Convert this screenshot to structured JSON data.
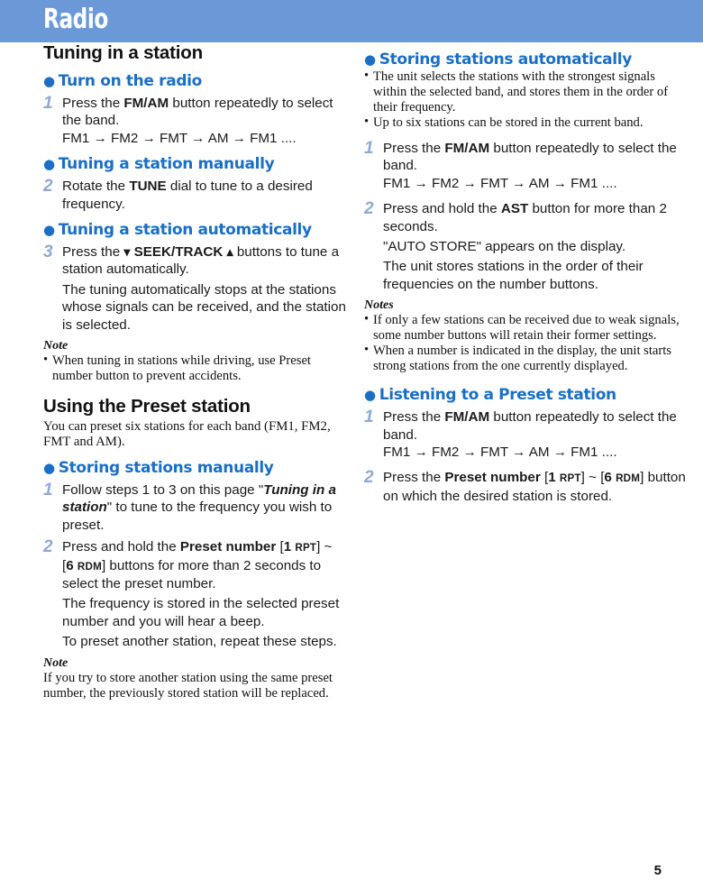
{
  "header": {
    "title": "Radio",
    "bar_color": "#6b99d8"
  },
  "colors": {
    "accent_blue": "#1a6fc4",
    "step_number_blue": "#8fa9d4",
    "header_blue": "#6b99d8"
  },
  "page_number": "5",
  "left_column": {
    "section_title": "Tuning in a station",
    "bullet_1": {
      "bullet": "●",
      "label": "Turn on the radio"
    },
    "step_1": {
      "number": "1",
      "line_prefix": "Press the ",
      "button": "FM/AM",
      "line_suffix": " button repeatedly to select the band.",
      "band_sequence": "FM1 → FM2 → FMT → AM → FM1 ...."
    },
    "bullet_2": {
      "bullet": "●",
      "label": "Tuning a station manually"
    },
    "step_2": {
      "number": "2",
      "line_prefix": "Rotate the ",
      "button": "TUNE",
      "line_suffix": " dial to tune to a desired frequency."
    },
    "bullet_3": {
      "bullet": "●",
      "label": "Tuning a station automatically"
    },
    "step_3": {
      "number": "3",
      "line_prefix": "Press the ",
      "chevron_down": "⌄",
      "button": "SEEK/TRACK",
      "chevron_up": "⌃",
      "line_suffix": " buttons to tune a station automatically.",
      "sub_line": "The tuning automatically stops at the stations whose signals can be received, and the station is selected."
    },
    "note": {
      "label": "Note",
      "bullet": "•",
      "text": "When tuning in stations while driving, use Preset number button to prevent accidents."
    },
    "section_title_2": "Using the Preset station",
    "intro_paragraph": "You can preset six stations for each band (FM1, FM2, FMT and AM).",
    "bullet_4": {
      "bullet": "●",
      "label": "Storing stations manually"
    },
    "step_4": {
      "number": "1",
      "line_prefix": "Follow steps 1 to 3 on this page \"",
      "reference": "Tuning in a station",
      "line_suffix": "\" to tune to the frequency you wish to preset."
    },
    "step_5": {
      "number": "2",
      "line_prefix": "Press and hold the ",
      "button": "Preset number",
      "bracket_open": " [",
      "preset_low_num": "1",
      "preset_low_sc": "RPT",
      "bracket_mid": "] ~ [",
      "preset_high_num": "6",
      "preset_high_sc": "RDM",
      "bracket_close": "]",
      "line_suffix": " buttons for more than 2 seconds to select the preset number.",
      "sub_line_1": "The frequency is stored in the selected preset number and you will hear a beep.",
      "sub_line_2": "To preset another station, repeat these steps."
    },
    "note_2": {
      "label": "Note",
      "text": "If you try to store another station using the same preset number, the previously stored station will be replaced."
    }
  },
  "right_column": {
    "bullet_1": {
      "bullet": "●",
      "label": "Storing stations automatically"
    },
    "notes_top": [
      {
        "bullet": "•",
        "text": "The unit selects the stations with the strongest signals within the selected band, and stores them in the order of their frequency."
      },
      {
        "bullet": "•",
        "text": "Up to six stations can be stored in the current band."
      }
    ],
    "step_1": {
      "number": "1",
      "line_prefix": "Press the ",
      "button": "FM/AM",
      "line_suffix": " button repeatedly to select the band.",
      "band_sequence": "FM1 → FM2 → FMT → AM → FM1 ...."
    },
    "step_2": {
      "number": "2",
      "line_prefix": "Press and hold the ",
      "button": "AST",
      "line_suffix": " button for more than 2 seconds.",
      "sub_line_1": "\"AUTO STORE\" appears on the display.",
      "sub_line_2": "The unit stores stations in the order of their frequencies on the number buttons."
    },
    "notes": {
      "label": "Notes",
      "items": [
        {
          "bullet": "•",
          "text": "If only a few stations can be received due to weak signals, some number buttons will retain their former settings."
        },
        {
          "bullet": "•",
          "text": "When a number is indicated in the display, the unit starts strong stations from the one currently displayed."
        }
      ]
    },
    "bullet_2": {
      "bullet": "●",
      "label": "Listening to a Preset station"
    },
    "step_3": {
      "number": "1",
      "line_prefix": "Press the ",
      "button": "FM/AM",
      "line_suffix": " button repeatedly to select the band.",
      "band_sequence": "FM1 → FM2 → FMT → AM → FM1 ...."
    },
    "step_4": {
      "number": "2",
      "line_prefix": "Press the ",
      "button": "Preset number",
      "bracket_open": " [",
      "preset_low_num": "1",
      "preset_low_sc": "RPT",
      "bracket_mid": "] ~ [",
      "preset_high_num": "6",
      "preset_high_sc": "RDM",
      "bracket_close": "]",
      "line_suffix": " button on which the desired station is stored."
    }
  }
}
